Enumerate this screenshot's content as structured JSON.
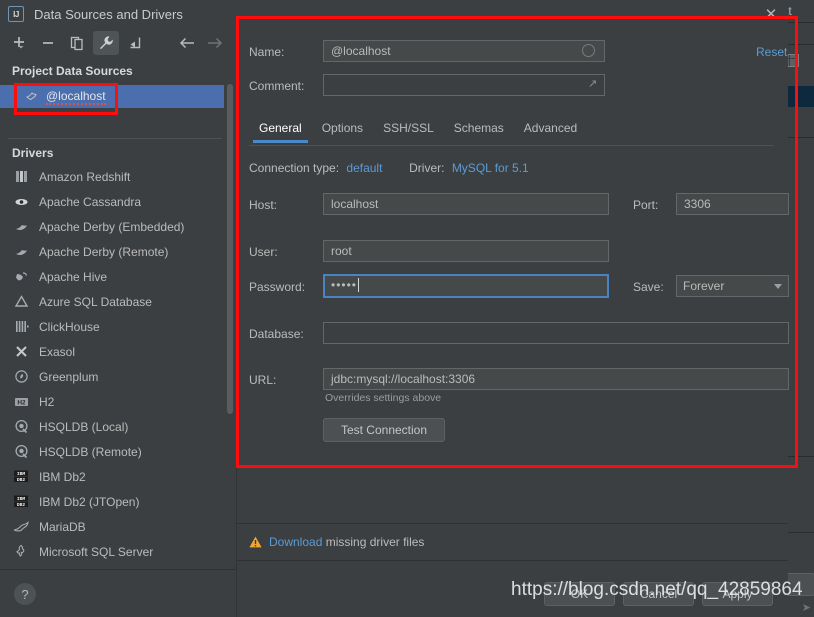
{
  "window": {
    "title": "Data Sources and Drivers",
    "app_icon": "intellij-idea-icon",
    "close_label": "✕"
  },
  "toolbar": {
    "buttons": [
      {
        "name": "add-button",
        "icon": "plus-icon",
        "label": "+",
        "active": false
      },
      {
        "name": "remove-button",
        "icon": "minus-icon",
        "label": "−",
        "active": false
      },
      {
        "name": "duplicate-button",
        "icon": "copy-icon",
        "label": "copy",
        "active": false
      },
      {
        "name": "properties-button",
        "icon": "wrench-icon",
        "label": "wrench",
        "active": true
      },
      {
        "name": "import-button",
        "icon": "import-arrow-icon",
        "label": "import",
        "active": false
      }
    ],
    "nav_back": {
      "name": "navigate-back-button",
      "icon": "arrow-left-icon"
    },
    "nav_forward": {
      "name": "navigate-forward-button",
      "icon": "arrow-right-icon"
    }
  },
  "sidebar": {
    "project_header": "Project Data Sources",
    "data_sources": [
      {
        "label": "@localhost",
        "icon": "mysql-dolphin-icon",
        "selected": true
      }
    ],
    "drivers_header": "Drivers",
    "drivers": [
      {
        "label": "Amazon Redshift",
        "icon": "redshift-icon"
      },
      {
        "label": "Apache Cassandra",
        "icon": "cassandra-eye-icon"
      },
      {
        "label": "Apache Derby (Embedded)",
        "icon": "derby-hat-icon"
      },
      {
        "label": "Apache Derby (Remote)",
        "icon": "derby-hat-icon"
      },
      {
        "label": "Apache Hive",
        "icon": "hive-bee-icon"
      },
      {
        "label": "Azure SQL Database",
        "icon": "azure-triangle-icon"
      },
      {
        "label": "ClickHouse",
        "icon": "clickhouse-bars-icon"
      },
      {
        "label": "Exasol",
        "icon": "exasol-x-icon"
      },
      {
        "label": "Greenplum",
        "icon": "greenplum-circle-icon"
      },
      {
        "label": "H2",
        "icon": "h2-icon"
      },
      {
        "label": "HSQLDB (Local)",
        "icon": "hsqldb-icon"
      },
      {
        "label": "HSQLDB (Remote)",
        "icon": "hsqldb-icon"
      },
      {
        "label": "IBM Db2",
        "icon": "ibm-db2-icon"
      },
      {
        "label": "IBM Db2 (JTOpen)",
        "icon": "ibm-db2-icon"
      },
      {
        "label": "MariaDB",
        "icon": "mariadb-seal-icon"
      },
      {
        "label": "Microsoft SQL Server",
        "icon": "mssql-icon"
      }
    ],
    "help_label": "?"
  },
  "form": {
    "name_label": "Name:",
    "name_value": "@localhost",
    "comment_label": "Comment:",
    "comment_value": "",
    "reset_label": "Reset"
  },
  "tabs": [
    {
      "label": "General",
      "selected": true
    },
    {
      "label": "Options",
      "selected": false
    },
    {
      "label": "SSH/SSL",
      "selected": false
    },
    {
      "label": "Schemas",
      "selected": false
    },
    {
      "label": "Advanced",
      "selected": false
    }
  ],
  "connection": {
    "connection_type_label": "Connection type:",
    "connection_type_value": "default",
    "driver_label": "Driver:",
    "driver_value": "MySQL for 5.1",
    "host_label": "Host:",
    "host_value": "localhost",
    "port_label": "Port:",
    "port_value": "3306",
    "user_label": "User:",
    "user_value": "root",
    "password_label": "Password:",
    "password_value": "•••••",
    "save_label": "Save:",
    "save_value": "Forever",
    "database_label": "Database:",
    "database_value": "",
    "url_label": "URL:",
    "url_value": "jdbc:mysql://localhost:3306",
    "url_hint": "Overrides settings above",
    "test_connection_label": "Test Connection"
  },
  "warning": {
    "icon": "warning-triangle-icon",
    "link_text": "Download",
    "rest_text": "missing driver files"
  },
  "footer": {
    "ok_label": "OK",
    "cancel_label": "Cancel",
    "apply_label": "Apply"
  },
  "background_window": {
    "tab_text": "oat"
  },
  "watermark": {
    "text": "https://blog.csdn.net/qq_42859864"
  },
  "colors": {
    "dialog_bg": "#3c3f41",
    "selection_blue": "#4b6eaf",
    "link_blue": "#5b9bd5",
    "focus_border": "#4b82c3",
    "annotation_red": "#fd0d0d",
    "warning_amber": "#f0a732"
  }
}
